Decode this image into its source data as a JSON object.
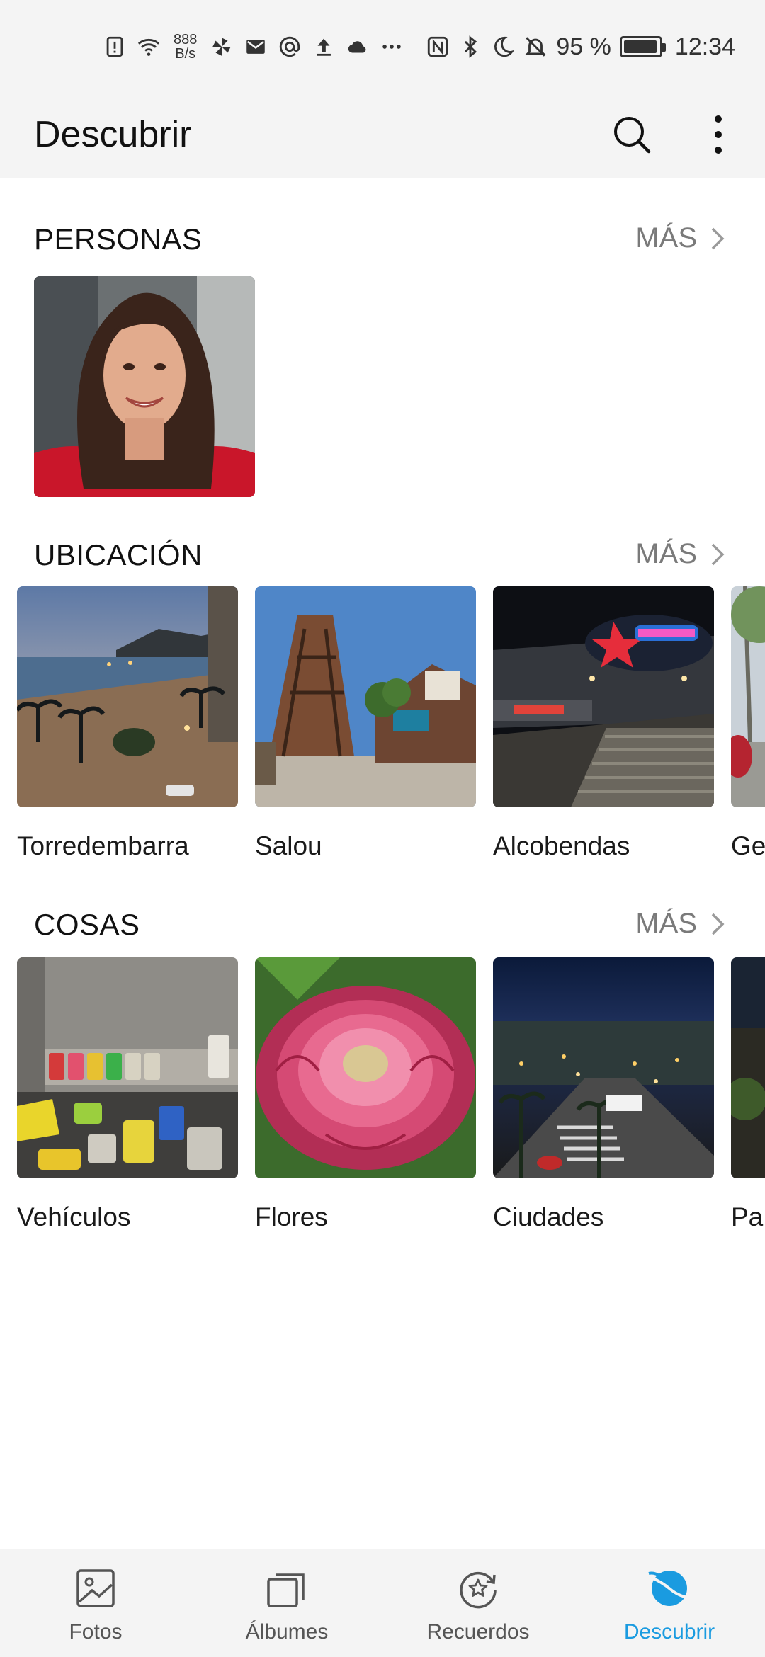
{
  "status_bar": {
    "net_speed_value": "888",
    "net_speed_unit": "B/s",
    "battery_percent": "95 %",
    "time": "12:34",
    "battery_level": 0.95,
    "icons": [
      "alert-icon",
      "wifi-icon",
      "pinwheel-icon",
      "mail-icon",
      "at-icon",
      "upload-icon",
      "cloud-icon",
      "more-dots-icon",
      "nfc-icon",
      "bluetooth-icon",
      "moon-icon",
      "bell-off-icon",
      "battery-icon"
    ]
  },
  "header": {
    "title": "Descubrir",
    "icons": [
      "search-icon",
      "more-vert-icon"
    ]
  },
  "sections": {
    "people": {
      "title": "PERSONAS",
      "more": "MÁS"
    },
    "location": {
      "title": "UBICACIÓN",
      "more": "MÁS",
      "items": [
        {
          "label": "Torredembarra"
        },
        {
          "label": "Salou"
        },
        {
          "label": "Alcobendas"
        },
        {
          "label": "Ge"
        }
      ]
    },
    "things": {
      "title": "COSAS",
      "more": "MÁS",
      "items": [
        {
          "label": "Vehículos"
        },
        {
          "label": "Flores"
        },
        {
          "label": "Ciudades"
        },
        {
          "label": "Pa"
        }
      ]
    }
  },
  "bottom_nav": {
    "items": [
      {
        "label": "Fotos",
        "icon": "photo-icon",
        "active": false
      },
      {
        "label": "Álbumes",
        "icon": "albums-icon",
        "active": false
      },
      {
        "label": "Recuerdos",
        "icon": "memories-icon",
        "active": false
      },
      {
        "label": "Descubrir",
        "icon": "discover-icon",
        "active": true
      }
    ]
  },
  "colors": {
    "accent": "#1a9be0",
    "bar_bg": "#f4f4f4",
    "text": "#1a1a1a",
    "muted": "#7a7a7a"
  }
}
